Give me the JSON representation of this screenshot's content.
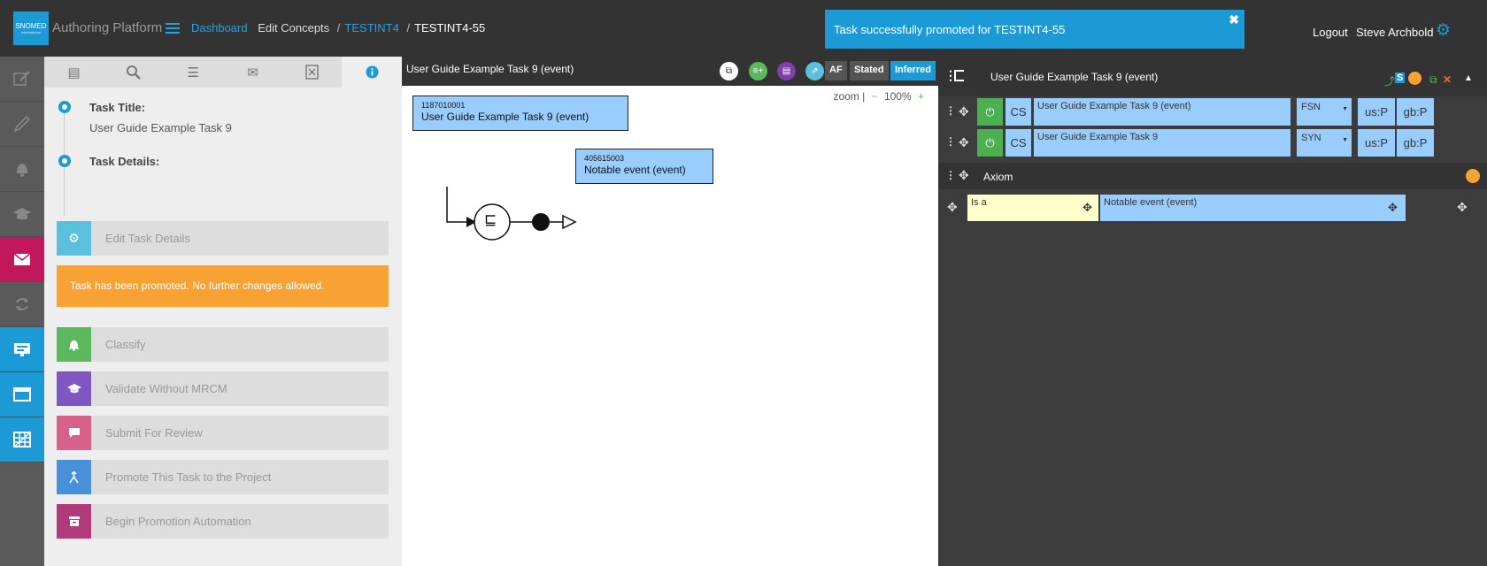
{
  "header": {
    "logo_text": "SNOMED",
    "logo_sub": "International",
    "app_title": "Authoring Platform",
    "breadcrumb": {
      "dashboard": "Dashboard",
      "edit_concepts": "Edit Concepts",
      "project": "TESTINT4",
      "task": "TESTINT4-55"
    },
    "toast": "Task successfully promoted for TESTINT4-55",
    "logout": "Logout",
    "user_name": "Steve Archbold"
  },
  "left_nav": {
    "items": [
      "edit-icon",
      "pen-icon",
      "bell-icon",
      "graduation-cap-icon",
      "mail-icon",
      "sync-icon",
      "monitor-icon",
      "window-icon",
      "grid-icon"
    ]
  },
  "info_panel": {
    "tabs": [
      "stack-icon",
      "search-icon",
      "list-icon",
      "mail-icon",
      "excel-icon",
      "info-icon"
    ],
    "task_title_label": "Task Title:",
    "task_title_value": "User Guide Example Task 9",
    "task_details_label": "Task Details:",
    "edit_task_details": "Edit Task Details",
    "promoted_message": "Task has been promoted. No further changes allowed.",
    "actions": {
      "classify": "Classify",
      "validate": "Validate Without MRCM",
      "submit": "Submit For Review",
      "promote": "Promote This Task to the Project",
      "automation": "Begin Promotion Automation"
    },
    "colors": {
      "edit": "#5bc0de",
      "classify": "#5cb85c",
      "validate": "#7e57c2",
      "submit": "#d9608a",
      "promote": "#4a90d9",
      "automation": "#b03a7a"
    }
  },
  "diagram": {
    "title": "User Guide Example Task 9 (event)",
    "af_label": "AF",
    "stated_label": "Stated",
    "inferred_label": "Inferred",
    "zoom_label": "zoom |",
    "zoom_minus": "−",
    "zoom_value": "100%",
    "zoom_plus": "+",
    "concept": {
      "id": "1187010001",
      "name": "User Guide Example Task 9 (event)"
    },
    "parent": {
      "id": "405615003",
      "name": "Notable event (event)"
    },
    "definition_symbol": "⊑"
  },
  "editor": {
    "title": "User Guide Example Task 9 (event)",
    "status_s": "S",
    "descriptions": [
      {
        "cs": "CS",
        "term": "User Guide Example Task 9 (event)",
        "type": "FSN",
        "us": "us:P",
        "gb": "gb:P"
      },
      {
        "cs": "CS",
        "term": "User Guide Example Task 9",
        "type": "SYN",
        "us": "us:P",
        "gb": "gb:P"
      }
    ],
    "axiom_label": "Axiom",
    "relationship": {
      "type": "Is a",
      "target": "Notable event (event)"
    }
  }
}
